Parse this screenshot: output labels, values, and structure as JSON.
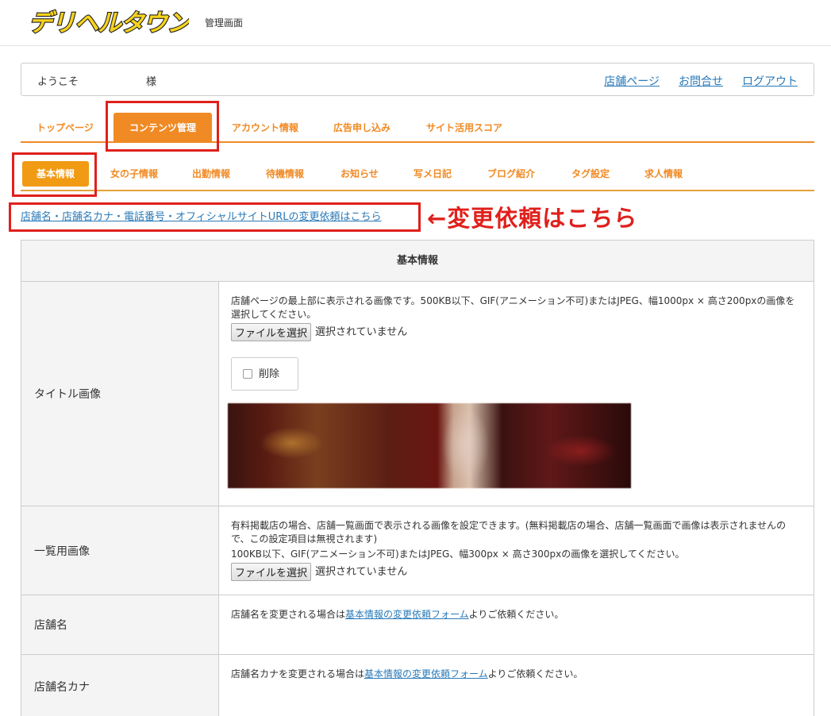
{
  "header": {
    "logo_text": "デリヘルタウン",
    "title": "管理画面"
  },
  "welcome": {
    "greeting": "ようこそ",
    "suffix": "様",
    "links": [
      "店舗ページ",
      "お問合せ",
      "ログアウト"
    ]
  },
  "main_tabs": [
    "トップページ",
    "コンテンツ管理",
    "アカウント情報",
    "広告申し込み",
    "サイト活用スコア"
  ],
  "sub_tabs": [
    "基本情報",
    "女の子情報",
    "出勤情報",
    "待機情報",
    "お知らせ",
    "写メ日記",
    "ブログ紹介",
    "タグ設定",
    "求人情報"
  ],
  "change_request_link": "店舗名・店舗名カナ・電話番号・オフィシャルサイトURLの変更依頼はこちら",
  "annotation": "←変更依頼はこちら",
  "table": {
    "header": "基本情報",
    "rows": [
      {
        "label": "タイトル画像",
        "desc": "店舗ページの最上部に表示される画像です。500KB以下、GIF(アニメーション不可)またはJPEG、幅1000px × 高さ200pxの画像を選択してください。",
        "file_button": "ファイルを選択",
        "file_status": "選択されていません",
        "delete_label": "削除"
      },
      {
        "label": "一覧用画像",
        "desc1": "有料掲載店の場合、店舗一覧画面で表示される画像を設定できます。(無料掲載店の場合、店舗一覧画面で画像は表示されませんので、この設定項目は無視されます)",
        "desc2": "100KB以下、GIF(アニメーション不可)またはJPEG、幅300px × 高さ300pxの画像を選択してください。",
        "file_button": "ファイルを選択",
        "file_status": "選択されていません"
      },
      {
        "label": "店舗名",
        "pre": "店舗名を変更される場合は",
        "link": "基本情報の変更依頼フォーム",
        "post": "よりご依頼ください。"
      },
      {
        "label": "店舗名カナ",
        "pre": "店舗名カナを変更される場合は",
        "link": "基本情報の変更依頼フォーム",
        "post": "よりご依頼ください。"
      }
    ]
  },
  "colors": {
    "accent": "#f08a24",
    "annotation_red": "#e0201c",
    "link": "#2a7ab8"
  }
}
